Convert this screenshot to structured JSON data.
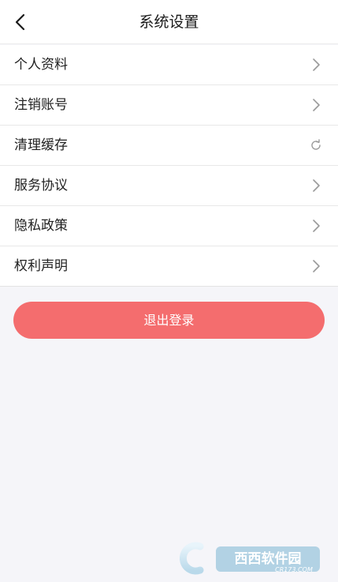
{
  "header": {
    "title": "系统设置",
    "back_icon": "chevron-left-icon"
  },
  "settings": {
    "items": [
      {
        "label": "个人资料",
        "icon": "chevron-right-icon"
      },
      {
        "label": "注销账号",
        "icon": "chevron-right-icon"
      },
      {
        "label": "清理缓存",
        "icon": "refresh-icon"
      },
      {
        "label": "服务协议",
        "icon": "chevron-right-icon"
      },
      {
        "label": "隐私政策",
        "icon": "chevron-right-icon"
      },
      {
        "label": "权利声明",
        "icon": "chevron-right-icon"
      }
    ]
  },
  "logout": {
    "label": "退出登录"
  },
  "watermark": {
    "text": "西西软件园",
    "url_text": "CR173.COM"
  },
  "colors": {
    "background": "#f5f5f9",
    "logout_button": "#f46d6e",
    "text": "#222222",
    "chevron": "#9a9a9a"
  }
}
